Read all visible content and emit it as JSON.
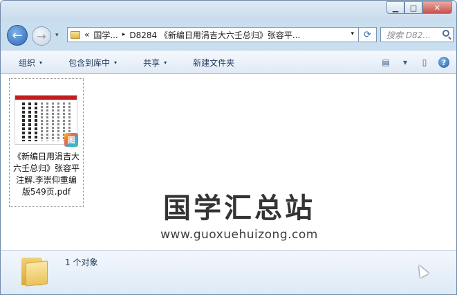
{
  "window": {
    "controls": {
      "minimize": "▁",
      "maximize": "□",
      "close": "✕"
    }
  },
  "navigation": {
    "back_icon": "←",
    "forward_icon": "→",
    "dropdown_icon": "▾",
    "address": {
      "overflow": "«",
      "segment_1": "国学...",
      "separator": "▸",
      "segment_2": "D8284 《新编日用涓吉大六壬总归》张容平...",
      "dropdown": "▾"
    },
    "refresh_icon": "⟳",
    "search_placeholder": "搜索 D82..."
  },
  "toolbar": {
    "organize": "组织",
    "include_in_library": "包含到库中",
    "share": "共享",
    "new_folder": "新建文件夹",
    "caret": "▾",
    "view_icon": "▤",
    "preview_pane_icon": "▯",
    "help_icon": "?"
  },
  "files": [
    {
      "name": "《新编日用涓吉大六壬总归》张容平注解.李崇仰重编版549页.pdf",
      "name_lines": [
        "《新编日用涓吉大",
        "六壬总归》张容平",
        "注解.李崇仰重编",
        "版549页.pdf"
      ],
      "badge": "PDF",
      "app_badge": "图"
    }
  ],
  "watermark": {
    "chinese": "国学汇总站",
    "url": "www.guoxuehuizong.com"
  },
  "details": {
    "count": "1 个对象"
  }
}
